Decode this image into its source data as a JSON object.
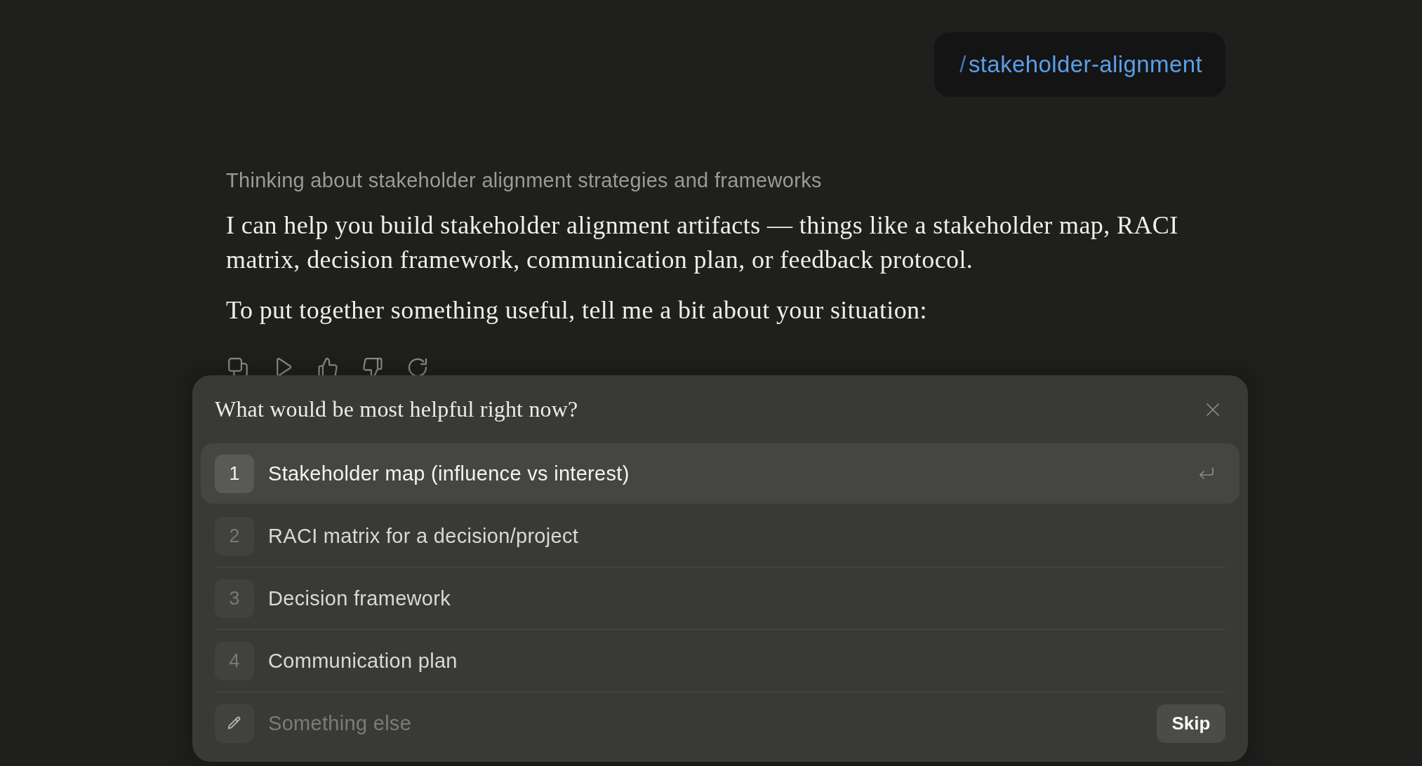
{
  "command_bubble": {
    "prefix": "/",
    "command": "stakeholder-alignment"
  },
  "thinking_summary": "Thinking about stakeholder alignment strategies and frameworks",
  "message": {
    "paragraphs": [
      "I can help you build stakeholder alignment artifacts — things like a stakeholder map, RACI matrix, decision framework, communication plan, or feedback protocol.",
      "To put together something useful, tell me a bit about your situation:"
    ]
  },
  "question_panel": {
    "title": "What would be most helpful right now?",
    "options": [
      {
        "kind": "numbered",
        "number": "1",
        "label": "Stakeholder map (influence vs interest)",
        "selected": true
      },
      {
        "kind": "numbered",
        "number": "2",
        "label": "RACI matrix for a decision/project",
        "selected": false
      },
      {
        "kind": "numbered",
        "number": "3",
        "label": "Decision framework",
        "selected": false
      },
      {
        "kind": "numbered",
        "number": "4",
        "label": "Communication plan",
        "selected": false
      },
      {
        "kind": "custom",
        "placeholder": "Something else"
      }
    ],
    "skip_button": "Skip"
  }
}
